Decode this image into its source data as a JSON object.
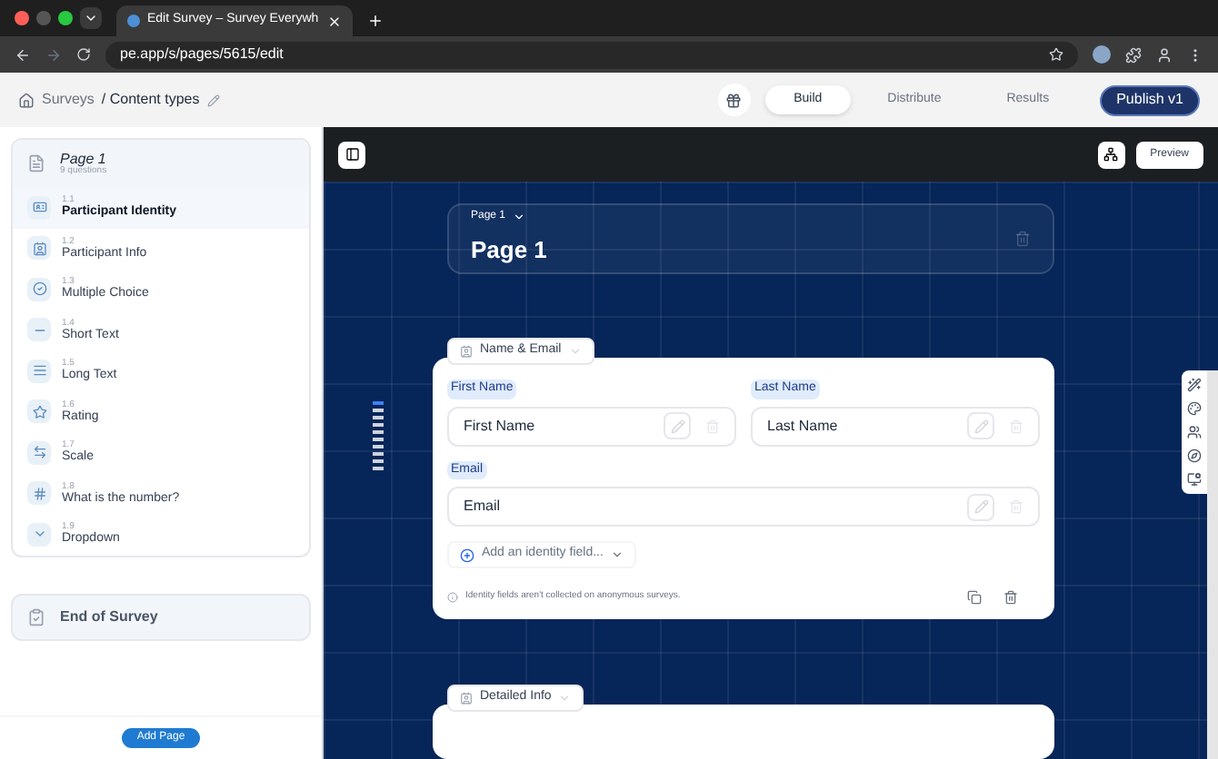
{
  "browser": {
    "tab_title": "Edit Survey – Survey Everywh",
    "url": "pe.app/s/pages/5615/edit"
  },
  "header": {
    "breadcrumb": [
      "Surveys",
      "/ Content types"
    ],
    "tabs": [
      {
        "label": "Build",
        "selected": true
      },
      {
        "label": "Distribute",
        "selected": false
      },
      {
        "label": "Results",
        "selected": false
      }
    ],
    "publish": "Publish v1"
  },
  "sidebar": {
    "page": {
      "title": "Page 1",
      "subtitle": "9 questions"
    },
    "questions": [
      {
        "number": "1.1",
        "label": "Participant Identity",
        "kind": "identity",
        "selected": true
      },
      {
        "number": "1.2",
        "label": "Participant Info",
        "kind": "info",
        "selected": false
      },
      {
        "number": "1.3",
        "label": "Multiple Choice",
        "kind": "choice",
        "selected": false
      },
      {
        "number": "1.4",
        "label": "Short Text",
        "kind": "short",
        "selected": false
      },
      {
        "number": "1.5",
        "label": "Long Text",
        "kind": "long",
        "selected": false
      },
      {
        "number": "1.6",
        "label": "Rating",
        "kind": "rating",
        "selected": false
      },
      {
        "number": "1.7",
        "label": "Scale",
        "kind": "scale",
        "selected": false
      },
      {
        "number": "1.8",
        "label": "What is the number?",
        "kind": "number",
        "selected": false
      },
      {
        "number": "1.9",
        "label": "Dropdown",
        "kind": "dropdown",
        "selected": false
      }
    ],
    "end": "End of Survey",
    "add_page": "Add Page"
  },
  "canvas": {
    "preview": "Preview",
    "page_card": {
      "dropdown": "Page 1",
      "title": "Page 1"
    },
    "blocks": [
      {
        "title": "Name & Email",
        "fields": [
          {
            "label": "First Name",
            "value": "First Name"
          },
          {
            "label": "Last Name",
            "value": "Last Name"
          },
          {
            "label": "Email",
            "value": "Email"
          }
        ],
        "add": "Add an identity field...",
        "note": "Identity fields aren't collected on anonymous surveys."
      },
      {
        "title": "Detailed Info"
      }
    ]
  }
}
